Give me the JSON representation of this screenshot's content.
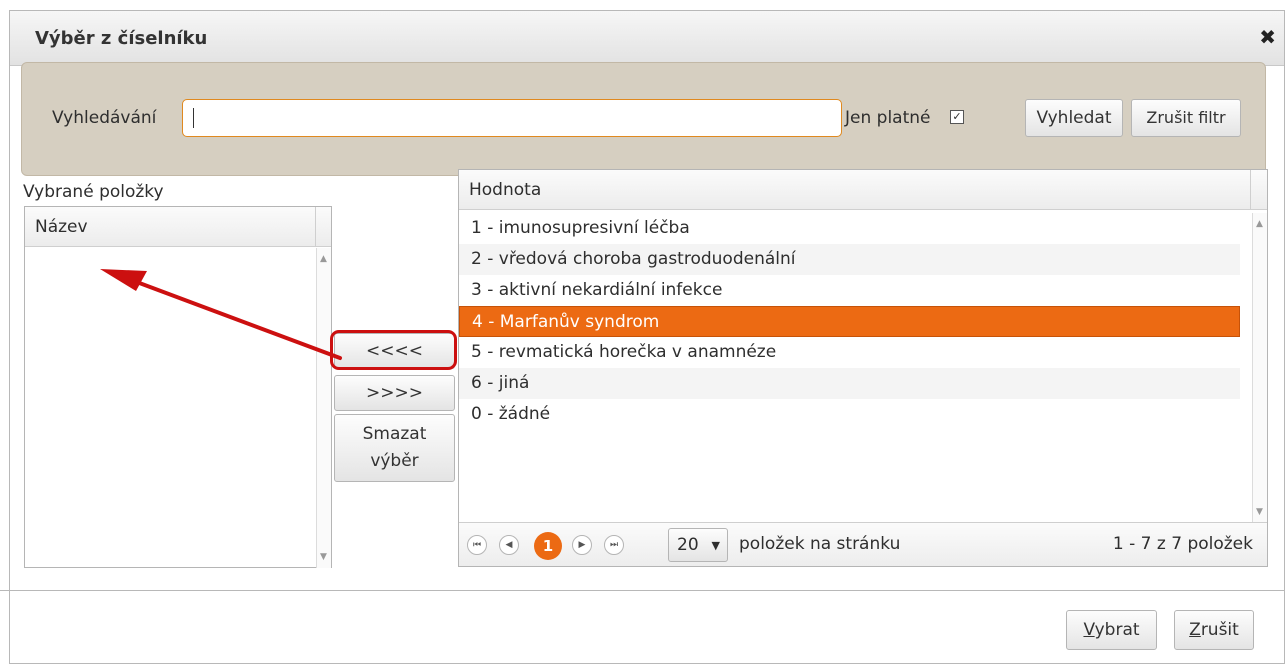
{
  "dialog": {
    "title": "Výběr z číselníku",
    "close_glyph": "✖"
  },
  "search": {
    "label": "Vyhledávání",
    "value": "",
    "valid_only_label": "Jen platné",
    "valid_only_checked": true,
    "search_button": "Vyhledat",
    "clear_filter_button": "Zrušit filtr"
  },
  "selected_panel": {
    "label": "Vybrané položky",
    "column_header": "Název",
    "items": []
  },
  "transfer": {
    "move_left": "<<<<",
    "move_right": ">>>>",
    "reset_line1": "Smazat",
    "reset_line2": "výběr"
  },
  "values_grid": {
    "column_header": "Hodnota",
    "rows": [
      {
        "label": "1 - imunosupresivní léčba"
      },
      {
        "label": "2 - vředová choroba gastroduodenální"
      },
      {
        "label": "3 - aktivní nekardiální infekce"
      },
      {
        "label": "4 - Marfanův syndrom",
        "selected": true
      },
      {
        "label": "5 - revmatická horečka v anamnéze"
      },
      {
        "label": "6 - jiná"
      },
      {
        "label": "0 - žádné"
      }
    ]
  },
  "pager": {
    "first_glyph": "⏮",
    "prev_glyph": "◀",
    "current_page": "1",
    "next_glyph": "▶",
    "last_glyph": "⏭",
    "page_size": "20",
    "page_size_arrow": "▼",
    "per_page_label": "položek na stránku",
    "info": "1 - 7 z 7 položek"
  },
  "footer": {
    "select_first": "V",
    "select_rest": "ybrat",
    "cancel_first": "Z",
    "cancel_rest": "rušit"
  },
  "colors": {
    "accent": "#ec6a13",
    "annotation": "#cc1010",
    "filter_bg": "#d6cfc1"
  }
}
